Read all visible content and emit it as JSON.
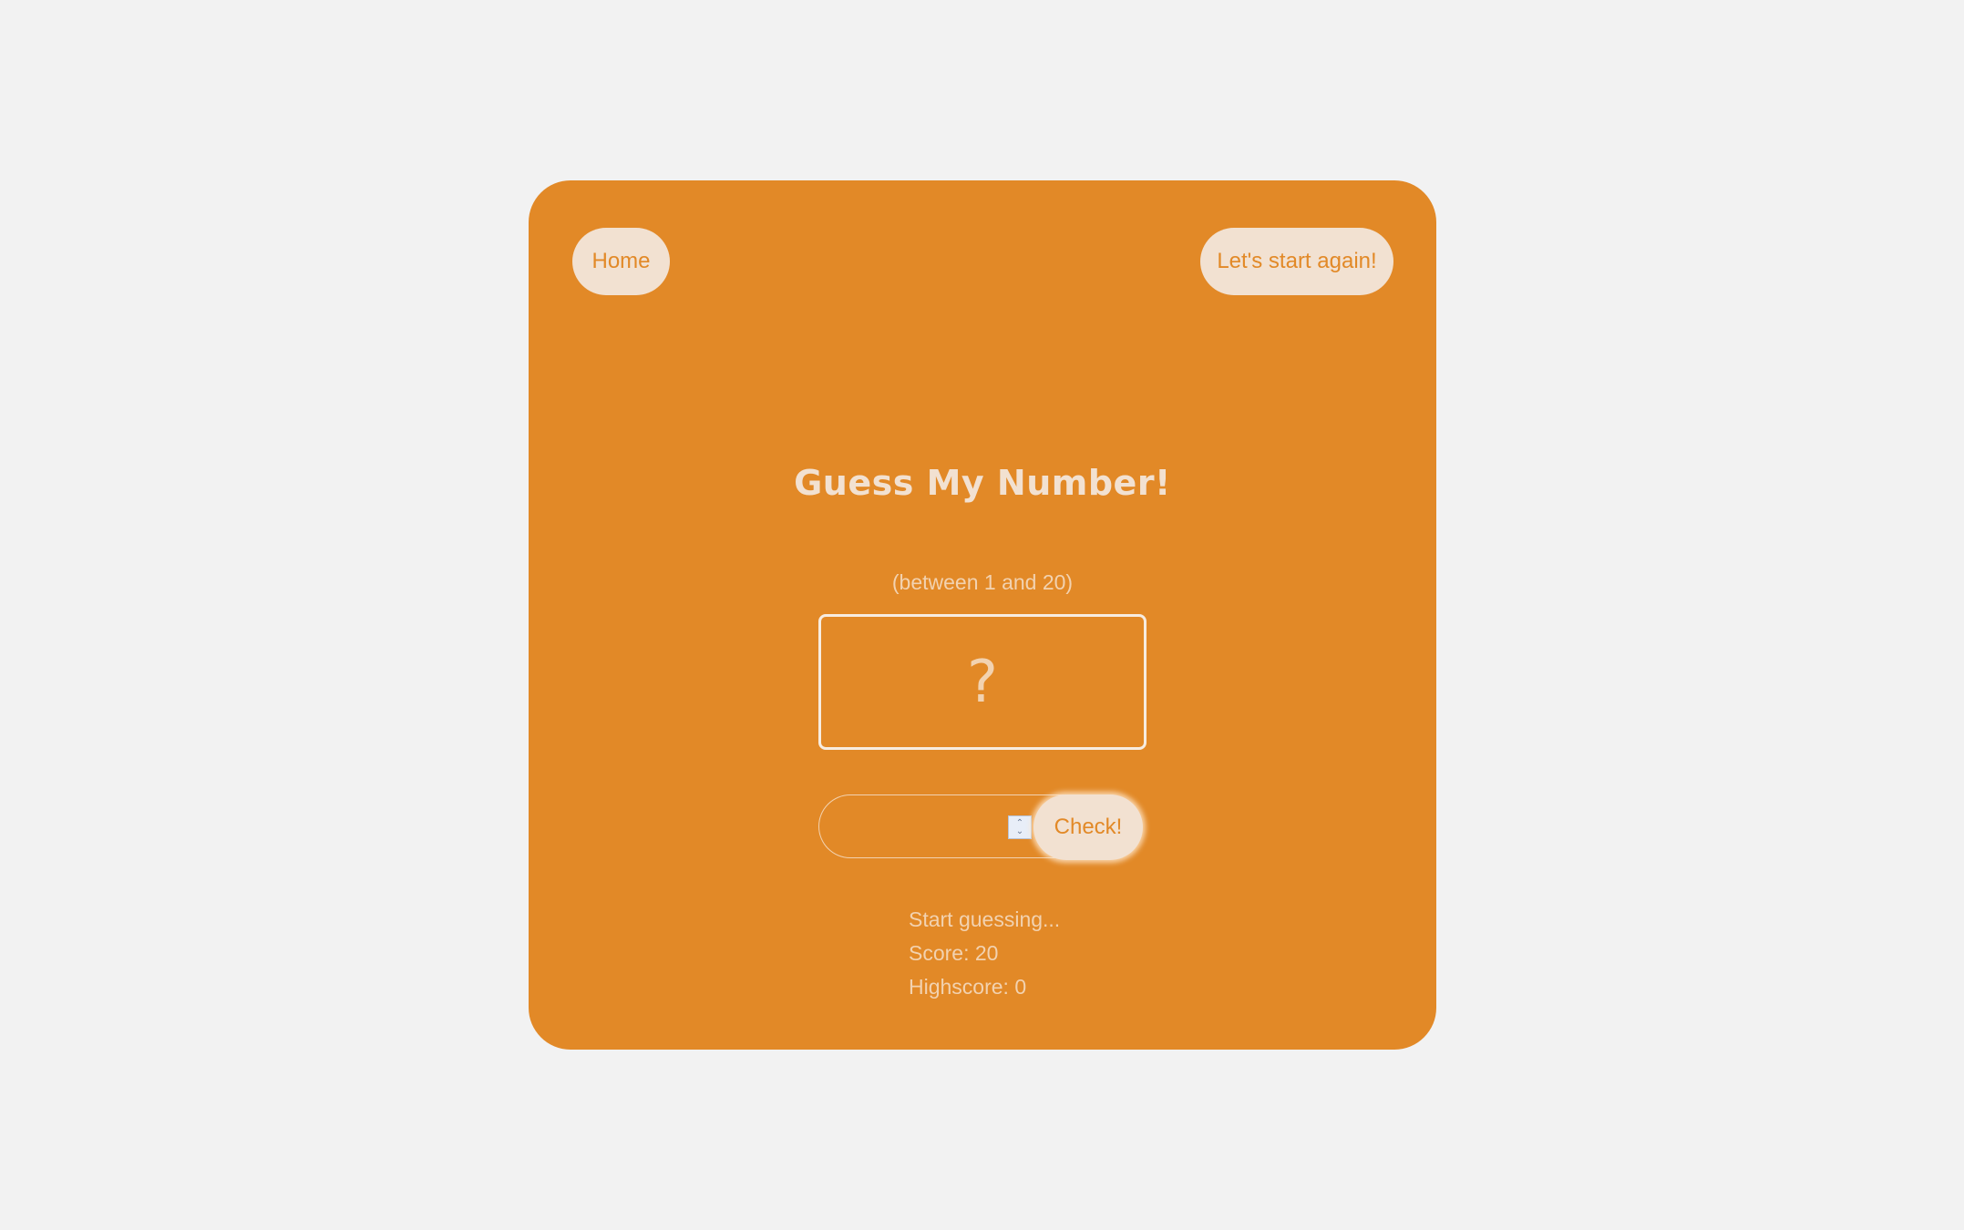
{
  "nav": {
    "home_label": "Home",
    "again_label": "Let's start again!"
  },
  "game": {
    "title": "Guess My Number!",
    "range_hint": "(between 1 and 20)",
    "secret_display": "?",
    "guess_value": "",
    "check_label": "Check!",
    "message": "Start guessing...",
    "score_text": "Score: 20",
    "highscore_text": "Highscore: 0"
  },
  "colors": {
    "page_background": "#f2f2f2",
    "card_background": "#e28927",
    "button_background": "#f2e1d1",
    "text_light": "#f2d2b0"
  },
  "icons": {
    "spinner": "number-spinner-icon"
  }
}
